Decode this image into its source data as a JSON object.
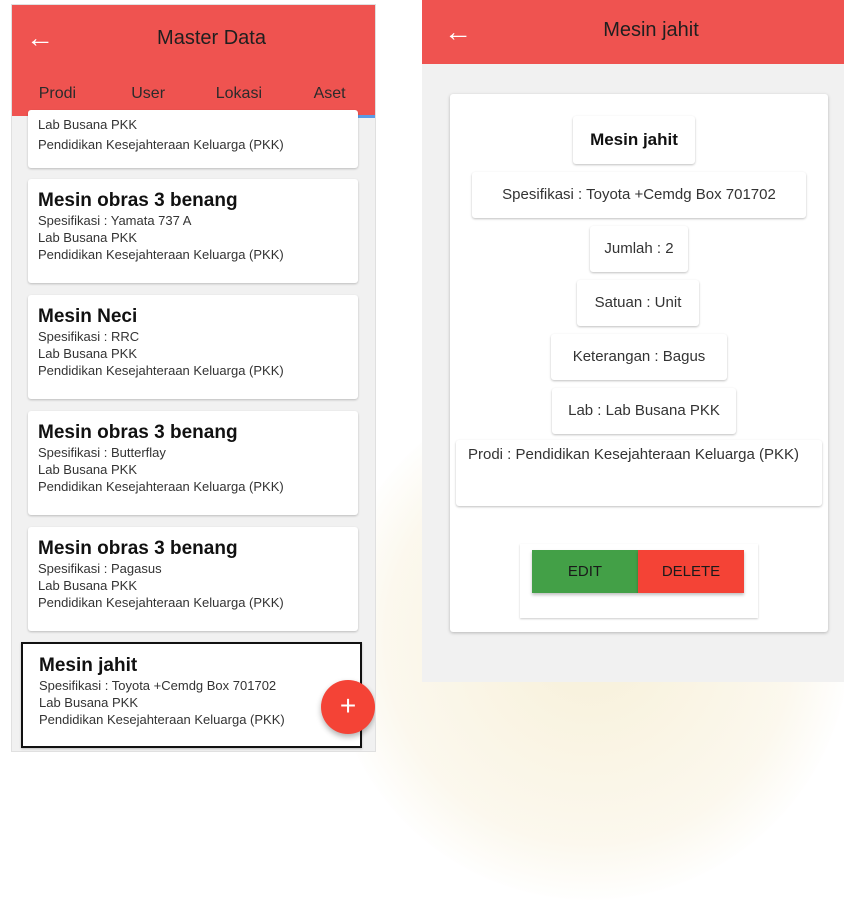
{
  "left": {
    "title": "Master Data",
    "back_icon": "←",
    "tabs": [
      "Prodi",
      "User",
      "Lokasi",
      "Aset"
    ],
    "active_tab": "Aset",
    "partial_card": {
      "lab": "Lab Busana PKK",
      "prodi": "Pendidikan Kesejahteraan Keluarga (PKK)"
    },
    "items": [
      {
        "name": "Mesin obras 3 benang",
        "spec": "Spesifikasi : Yamata 737 A",
        "lab": "Lab Busana PKK",
        "prodi": "Pendidikan Kesejahteraan Keluarga (PKK)"
      },
      {
        "name": "Mesin Neci",
        "spec": "Spesifikasi : RRC",
        "lab": "Lab Busana PKK",
        "prodi": "Pendidikan Kesejahteraan Keluarga (PKK)"
      },
      {
        "name": "Mesin obras  3 benang",
        "spec": "Spesifikasi : Butterflay",
        "lab": "Lab Busana PKK",
        "prodi": "Pendidikan Kesejahteraan Keluarga (PKK)"
      },
      {
        "name": "Mesin obras 3 benang",
        "spec": "Spesifikasi : Pagasus",
        "lab": "Lab Busana PKK",
        "prodi": "Pendidikan Kesejahteraan Keluarga (PKK)"
      },
      {
        "name": "Mesin jahit",
        "spec": "Spesifikasi : Toyota +Cemdg Box 701702",
        "lab": "Lab Busana PKK",
        "prodi": "Pendidikan Kesejahteraan Keluarga (PKK)"
      }
    ],
    "fab_icon": "+"
  },
  "right": {
    "title": "Mesin jahit",
    "back_icon": "←",
    "detail": {
      "name": "Mesin jahit",
      "spec": "Spesifikasi : Toyota +Cemdg Box 701702",
      "jumlah": "Jumlah : 2",
      "satuan": "Satuan : Unit",
      "keterangan": "Keterangan : Bagus",
      "lab": "Lab : Lab Busana PKK",
      "prodi": "Prodi : Pendidikan Kesejahteraan Keluarga (PKK)"
    },
    "edit_label": "EDIT",
    "delete_label": "DELETE"
  },
  "colors": {
    "appbar": "#ef5350",
    "tab_indicator": "#5a9be6",
    "fab": "#f44336",
    "edit": "#43a047",
    "delete": "#f44336"
  }
}
